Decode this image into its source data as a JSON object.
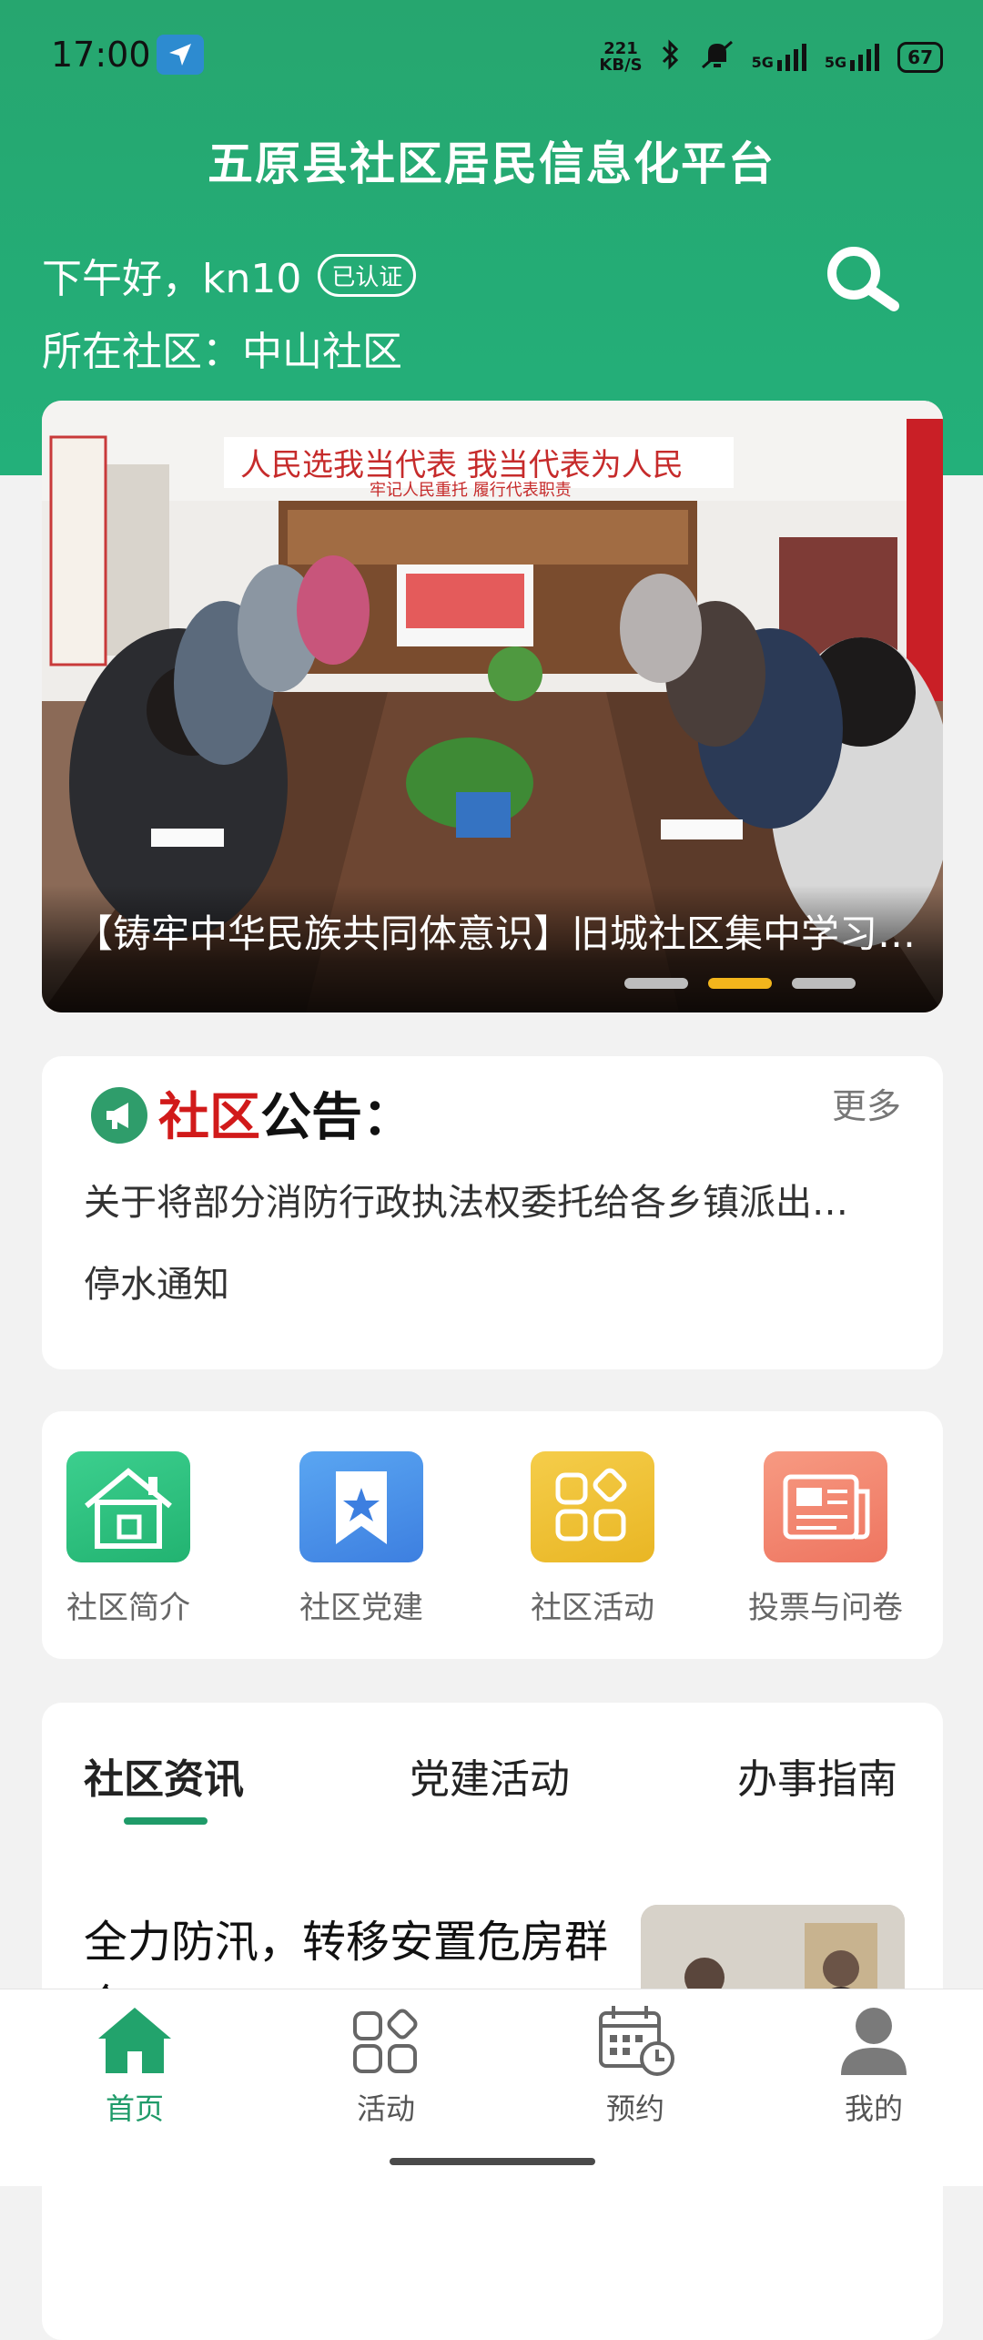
{
  "status_bar": {
    "time": "17:00",
    "net_speed_value": "221",
    "net_speed_unit": "KB/S",
    "signal_1": "5G",
    "signal_2": "5G",
    "battery": "67"
  },
  "header": {
    "app_title": "五原县社区居民信息化平台",
    "greeting": "下午好，kn10",
    "verified_badge": "已认证",
    "community": "所在社区：中山社区",
    "search_icon": "search-icon"
  },
  "banner": {
    "caption": "【铸牢中华民族共同体意识】旧城社区集中学习…",
    "slide_count": 3,
    "active_slide": 2,
    "wall_slogan": "人民选我当代表 我当代表为人民",
    "wall_subslogan": "牢记人民重托 履行代表职责"
  },
  "notice": {
    "title_red": "社区",
    "title_black": "公告：",
    "more": "更多",
    "items": [
      "关于将部分消防行政执法权委托给各乡镇派出…",
      "停水通知"
    ]
  },
  "features": [
    {
      "label": "社区简介",
      "icon": "house-icon",
      "color": "#2fbf80"
    },
    {
      "label": "社区党建",
      "icon": "star-bookmark-icon",
      "color": "#4a8fe8"
    },
    {
      "label": "社区活动",
      "icon": "apps-icon",
      "color": "#f0c03a"
    },
    {
      "label": "投票与问卷",
      "icon": "newspaper-icon",
      "color": "#f2846b"
    }
  ],
  "news": {
    "tabs": [
      "社区资讯",
      "党建活动",
      "办事指南"
    ],
    "active_tab": 0,
    "first_item_title": "全力防汛，转移安置危房群众"
  },
  "bottom_nav": [
    {
      "label": "首页",
      "icon": "home-icon",
      "active": true
    },
    {
      "label": "活动",
      "icon": "apps-icon",
      "active": false
    },
    {
      "label": "预约",
      "icon": "calendar-clock-icon",
      "active": false
    },
    {
      "label": "我的",
      "icon": "user-icon",
      "active": false
    }
  ],
  "colors": {
    "brand_green": "#23a873",
    "accent_red": "#d11a1a",
    "dot_active": "#f2b51c"
  }
}
